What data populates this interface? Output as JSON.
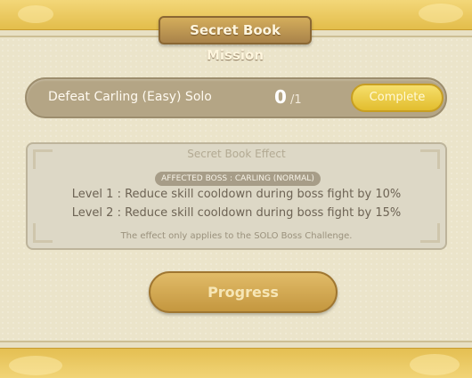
{
  "header": {
    "title": "Secret Book Mission"
  },
  "mission": {
    "label": "Defeat Carling (Easy) Solo",
    "count": "0",
    "total": "/1",
    "complete_label": "Complete"
  },
  "effect": {
    "title": "Secret Book Effect",
    "boss_label": "AFFECTED BOSS : CARLING (NORMAL)",
    "level1": "Level 1 : Reduce skill cooldown during boss fight by 10%",
    "level2": "Level 2 : Reduce skill cooldown during boss fight by 15%",
    "note": "The effect only applies to the SOLO Boss Challenge."
  },
  "actions": {
    "progress_label": "Progress"
  },
  "colors": {
    "gold_band": "#e3bd4b",
    "panel_bg": "#ebe4ca",
    "mission_bar": "#b4a585",
    "complete_button": "#e2bd2e",
    "progress_button": "#c4973f"
  }
}
